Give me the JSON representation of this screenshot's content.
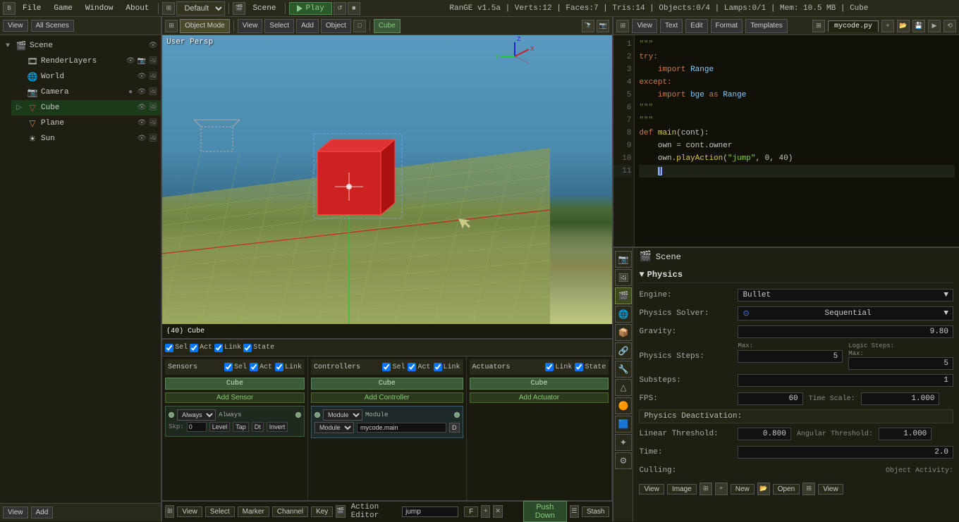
{
  "menubar": {
    "icon": "B",
    "items": [
      "File",
      "Game",
      "Window",
      "About"
    ],
    "workspace": "Default",
    "scene_label": "Scene",
    "play_label": "Play",
    "status": "RanGE v1.5a | Verts:12 | Faces:7 | Tris:14 | Objects:0/4 | Lamps:0/1 | Mem: 10.5 MB | Cube"
  },
  "left_panel": {
    "header": {
      "view_label": "View",
      "search_label": "All Scenes"
    },
    "outliner": {
      "scene_label": "Scene",
      "items": [
        {
          "name": "RenderLayers",
          "icon": "🎞",
          "indent": 1
        },
        {
          "name": "World",
          "icon": "🌐",
          "indent": 1
        },
        {
          "name": "Camera",
          "icon": "📷",
          "indent": 1,
          "has_dot": true
        },
        {
          "name": "Cube",
          "icon": "▽",
          "indent": 1,
          "selected": true
        },
        {
          "name": "Plane",
          "icon": "▽",
          "indent": 1
        },
        {
          "name": "Sun",
          "icon": "☀",
          "indent": 1
        }
      ]
    }
  },
  "viewport": {
    "label": "User Persp",
    "frame_label": "(40) Cube",
    "toolbar": {
      "view": "View",
      "select": "Select",
      "add": "Add",
      "object": "Object",
      "mode": "Object Mode",
      "cube_label": "Cube"
    }
  },
  "code_editor": {
    "toolbar": {
      "view": "View",
      "text": "Text",
      "edit": "Edit",
      "format": "Format",
      "templates": "Templates",
      "filename": "mycode.py"
    },
    "lines": [
      {
        "num": 1,
        "text": "\"\"\"",
        "type": "comment"
      },
      {
        "num": 2,
        "text": "try:",
        "type": "keyword"
      },
      {
        "num": 3,
        "text": "    import Range",
        "type": "normal"
      },
      {
        "num": 4,
        "text": "except:",
        "type": "keyword"
      },
      {
        "num": 5,
        "text": "    import bge as Range",
        "type": "normal"
      },
      {
        "num": 6,
        "text": "\"\"\"",
        "type": "comment"
      },
      {
        "num": 7,
        "text": "\"\"\"",
        "type": "comment"
      },
      {
        "num": 8,
        "text": "def main(cont):",
        "type": "def"
      },
      {
        "num": 9,
        "text": "    own = cont.owner",
        "type": "normal"
      },
      {
        "num": 10,
        "text": "    own.playAction(\"jump\", 0, 40)",
        "type": "normal"
      },
      {
        "num": 11,
        "text": "|",
        "type": "cursor"
      }
    ]
  },
  "properties": {
    "scene_label": "Scene",
    "physics_title": "Physics",
    "engine_label": "Engine:",
    "engine_value": "Bullet",
    "solver_label": "Physics Solver:",
    "solver_value": "Sequential",
    "gravity_label": "Gravity:",
    "gravity_value": "9.80",
    "steps_label": "Physics Steps:",
    "steps_max_label": "Max:",
    "steps_max_value": "5",
    "steps_sub_label": "Substeps:",
    "steps_sub_value": "1",
    "fps_label": "FPS:",
    "fps_value": "60",
    "timescale_label": "Time Scale:",
    "timescale_value": "1.000",
    "logic_steps_label": "Logic Steps:",
    "logic_steps_max_label": "Max:",
    "logic_steps_max_value": "5",
    "deactivation_label": "Physics Deactivation:",
    "linear_label": "Linear Threshold:",
    "linear_value": "0.800",
    "angular_label": "Angular Threshold:",
    "angular_value": "1.000",
    "time_label": "Time:",
    "time_value": "2.0",
    "culling_label": "Culling:",
    "activity_label": "Object Activity:"
  },
  "logic_editor": {
    "sensors_label": "Sensors",
    "controllers_label": "Controllers",
    "actuators_label": "Actuators",
    "add_sensor": "Add Sensor",
    "add_controller": "Add Controller",
    "add_actuator": "Add Actuator",
    "cube_label": "Cube",
    "sensor_type": "Always",
    "controller_type": "Module",
    "module_value": "mycode.main",
    "checks": {
      "sel": "Sel",
      "act": "Act",
      "link": "Link",
      "state": "State"
    }
  },
  "action_editor": {
    "view": "View",
    "select": "Select",
    "marker": "Marker",
    "channel": "Channel",
    "key": "Key",
    "editor_label": "Action Editor",
    "action_name": "jump",
    "push_down": "Push Down",
    "stash": "Stash"
  },
  "bottom_toolbar": {
    "view": "View",
    "add": "Add"
  }
}
